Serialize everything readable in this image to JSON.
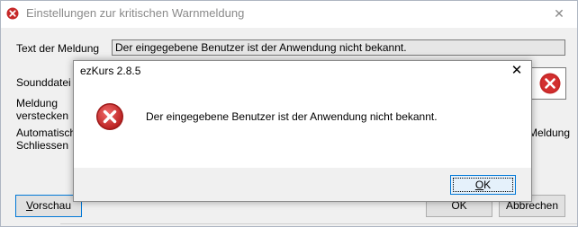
{
  "window": {
    "title": "Einstellungen zur kritischen Warnmeldung",
    "close_glyph": "✕"
  },
  "form": {
    "text_label": "Text der Meldung",
    "text_value": "Der eingegebene Benutzer ist der Anwendung nicht bekannt.",
    "sound_label": "Sounddatei",
    "hide_label_line1": "Meldung",
    "hide_label_line2": "verstecken",
    "auto_close_line1": "Automatische",
    "auto_close_line2": "Schliessen",
    "right_partial": "Meldung",
    "icon_name": "error-icon"
  },
  "buttons": {
    "preview_first": "V",
    "preview_rest": "orschau",
    "ok_bg": "OK",
    "cancel": "Abbrechen"
  },
  "dialog": {
    "title": "ezKurs 2.8.5",
    "close_glyph": "✕",
    "message": "Der eingegebene Benutzer ist der Anwendung nicht bekannt.",
    "ok_first": "O",
    "ok_rest": "K",
    "icon_name": "error-icon"
  },
  "colors": {
    "error_red": "#d32f2f",
    "focus_blue": "#0078d7"
  }
}
